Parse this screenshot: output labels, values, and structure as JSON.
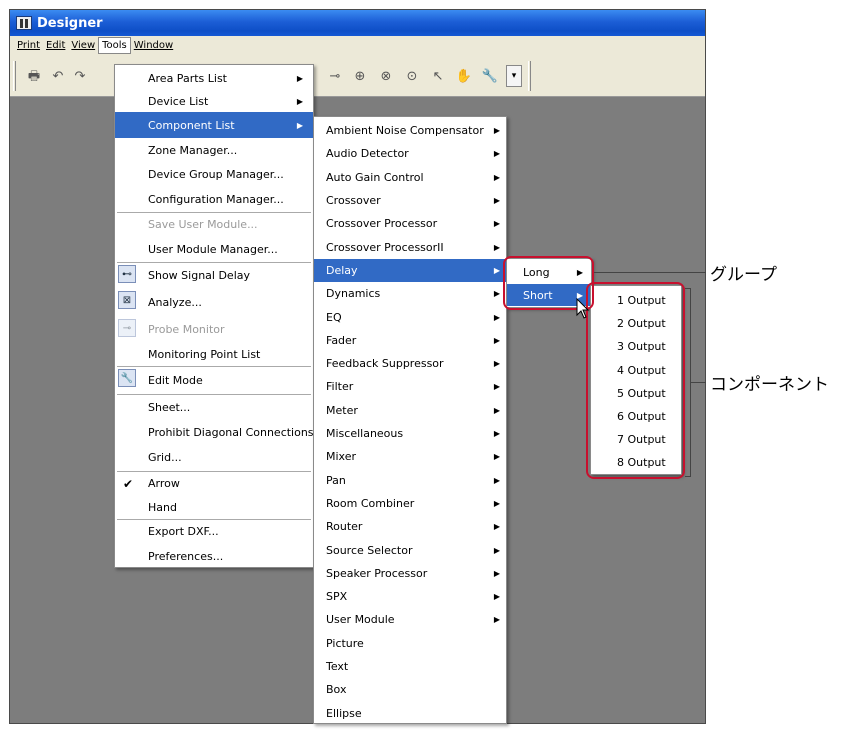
{
  "window": {
    "title": "Designer"
  },
  "menubar": [
    "Print",
    "Edit",
    "View",
    "Tools",
    "Window"
  ],
  "toolbar_icons": [
    "print-icon",
    "undo-icon",
    "redo-icon",
    "probe-icon",
    "zoom-in-icon",
    "zoom-out-icon",
    "zoom-reset-icon",
    "arrow-icon",
    "hand-icon",
    "edit-mode-icon",
    "dropdown-icon"
  ],
  "tools_menu": [
    {
      "label": "Area Parts List",
      "submenu": true,
      "disabled": false
    },
    {
      "label": "Device List",
      "submenu": true,
      "disabled": false
    },
    {
      "label": "Component List",
      "submenu": true,
      "selected": true
    },
    {
      "label": "Zone Manager..."
    },
    {
      "label": "Device Group Manager..."
    },
    {
      "label": "Configuration Manager..."
    },
    {
      "label": "Save User Module...",
      "disabled": true
    },
    {
      "label": "User Module Manager..."
    },
    {
      "label": "Show Signal Delay",
      "icon": "signal-delay-icon"
    },
    {
      "label": "Analyze...",
      "icon": "analyze-icon"
    },
    {
      "label": "Probe Monitor",
      "icon": "probe-monitor-icon",
      "disabled": true
    },
    {
      "label": "Monitoring Point List"
    },
    {
      "label": "Edit Mode",
      "icon": "edit-mode-icon"
    },
    {
      "label": "Sheet..."
    },
    {
      "label": "Prohibit Diagonal Connections"
    },
    {
      "label": "Grid..."
    },
    {
      "label": "Arrow",
      "checked": true,
      "check_mark": "✔"
    },
    {
      "label": "Hand"
    },
    {
      "label": "Export DXF..."
    },
    {
      "label": "Preferences..."
    }
  ],
  "component_menu": [
    "Ambient Noise Compensator",
    "Audio Detector",
    "Auto Gain Control",
    "Crossover",
    "Crossover Processor",
    "Crossover ProcessorII",
    "Delay",
    "Dynamics",
    "EQ",
    "Fader",
    "Feedback Suppressor",
    "Filter",
    "Meter",
    "Miscellaneous",
    "Mixer",
    "Pan",
    "Room Combiner",
    "Router",
    "Source Selector",
    "Speaker Processor",
    "SPX",
    "User Module",
    "Picture",
    "Text",
    "Box",
    "Ellipse"
  ],
  "component_submenu_count": 22,
  "component_selected": "Delay",
  "delay_menu": [
    "Long",
    "Short"
  ],
  "delay_selected": "Short",
  "short_menu": [
    "1 Output",
    "2 Output",
    "3 Output",
    "4 Output",
    "5 Output",
    "6 Output",
    "7 Output",
    "8 Output"
  ],
  "annotations": {
    "group": "グループ",
    "component": "コンポーネント"
  },
  "colors": {
    "highlight": "#316ac5",
    "callout": "#c8102e",
    "titlebar": "#0e4fc7"
  }
}
